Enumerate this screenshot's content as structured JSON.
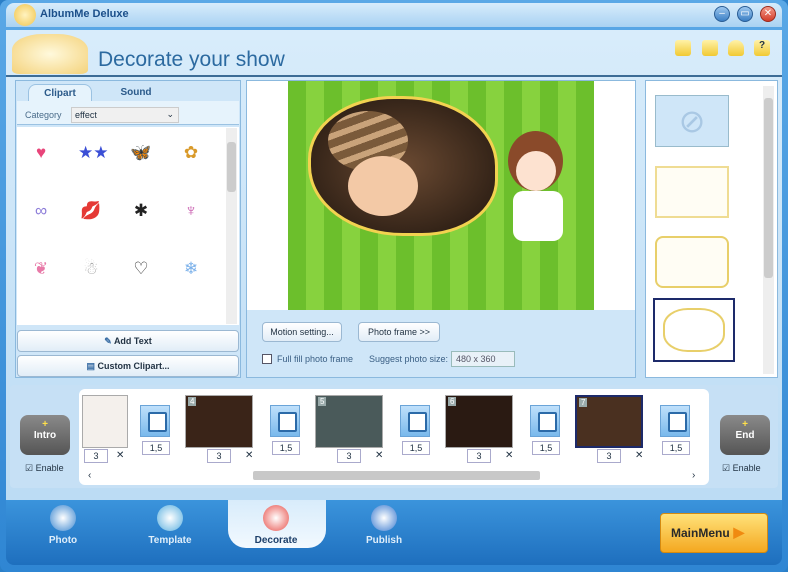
{
  "window": {
    "title": "AlbumMe Deluxe",
    "controls": [
      "minimize",
      "restore",
      "close"
    ]
  },
  "header": {
    "title": "Decorate your show",
    "icons": [
      "folder-icon",
      "note-icon",
      "user-icon",
      "help-icon"
    ]
  },
  "left_panel": {
    "tabs": [
      "Clipart",
      "Sound"
    ],
    "active_tab": "Clipart",
    "category_label": "Category",
    "category_value": "effect",
    "clipart": [
      "♥",
      "★★",
      "🦋",
      "✿",
      "∞",
      "💋",
      "✱",
      "♆",
      "❦",
      "☃",
      "♡",
      "❄"
    ],
    "add_text": "Add Text",
    "custom_clipart": "Custom Clipart..."
  },
  "preview": {
    "motion_setting": "Motion setting...",
    "photo_frame": "Photo frame >>",
    "full_fill_label": "Full fill photo frame",
    "full_fill_checked": false,
    "suggest_label": "Suggest photo size:",
    "suggest_value": "480 x 360"
  },
  "frames": {
    "count": 4,
    "selected_index": 3
  },
  "timeline": {
    "intro": {
      "label": "Intro",
      "enable_label": "Enable",
      "enabled": true
    },
    "end": {
      "label": "End",
      "enable_label": "Enable",
      "enabled": true
    },
    "slides": [
      {
        "badge": "",
        "duration": "3"
      },
      {
        "badge": "4",
        "duration": "3"
      },
      {
        "badge": "5",
        "duration": "3"
      },
      {
        "badge": "6",
        "duration": "3"
      },
      {
        "badge": "7",
        "duration": "3"
      }
    ],
    "transitions": [
      "1,5",
      "1,5",
      "1,5",
      "1,5",
      "1,5"
    ],
    "selected_slide": 4
  },
  "nav": {
    "items": [
      "Photo",
      "Template",
      "Decorate",
      "Publish"
    ],
    "active": "Decorate",
    "main_menu": "MainMenu"
  },
  "colors": {
    "accent": "#2f86d3",
    "active_tab": "#e6f3fc",
    "main_menu": "#f7b928"
  }
}
